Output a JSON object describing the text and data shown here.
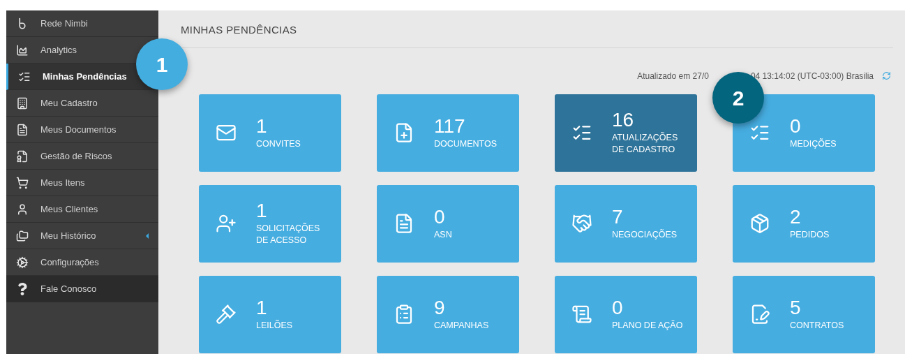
{
  "sidebar": {
    "items": [
      {
        "label": "Rede Nimbi",
        "selected": false,
        "kind": "item",
        "has_submenu": false
      },
      {
        "label": "Analytics",
        "selected": false,
        "kind": "item",
        "has_submenu": false
      },
      {
        "label": "Minhas Pendências",
        "selected": true,
        "kind": "item",
        "has_submenu": false
      },
      {
        "label": "Meu Cadastro",
        "selected": false,
        "kind": "item",
        "has_submenu": false
      },
      {
        "label": "Meus Documentos",
        "selected": false,
        "kind": "item",
        "has_submenu": false
      },
      {
        "label": "Gestão de Riscos",
        "selected": false,
        "kind": "item",
        "has_submenu": false
      },
      {
        "label": "Meus Itens",
        "selected": false,
        "kind": "item",
        "has_submenu": false
      },
      {
        "label": "Meus Clientes",
        "selected": false,
        "kind": "item",
        "has_submenu": false
      },
      {
        "label": "Meu Histórico",
        "selected": false,
        "kind": "item",
        "has_submenu": true
      },
      {
        "label": "Configurações",
        "selected": false,
        "kind": "item",
        "has_submenu": false
      },
      {
        "label": "Fale Conosco",
        "selected": false,
        "kind": "contact",
        "has_submenu": false
      }
    ]
  },
  "page": {
    "title": "MINHAS PENDÊNCIAS",
    "updated_before": "Atualizado em 27/0",
    "updated_after": "04 13:14:02 (UTC-03:00) Brasilia"
  },
  "cards": [
    {
      "count": "1",
      "label": "CONVITES",
      "selected": false
    },
    {
      "count": "117",
      "label": "DOCUMENTOS",
      "selected": false
    },
    {
      "count": "16",
      "label": "ATUALIZAÇÕES DE CADASTRO",
      "selected": true
    },
    {
      "count": "0",
      "label": "MEDIÇÕES",
      "selected": false
    },
    {
      "count": "1",
      "label": "SOLICITAÇÕES DE ACESSO",
      "selected": false
    },
    {
      "count": "0",
      "label": "ASN",
      "selected": false
    },
    {
      "count": "7",
      "label": "NEGOCIAÇÕES",
      "selected": false
    },
    {
      "count": "2",
      "label": "PEDIDOS",
      "selected": false
    },
    {
      "count": "1",
      "label": "LEILÕES",
      "selected": false
    },
    {
      "count": "9",
      "label": "CAMPANHAS",
      "selected": false
    },
    {
      "count": "0",
      "label": "PLANO DE AÇÃO",
      "selected": false
    },
    {
      "count": "5",
      "label": "CONTRATOS",
      "selected": false
    }
  ],
  "callouts": [
    {
      "number": "1"
    },
    {
      "number": "2"
    }
  ]
}
